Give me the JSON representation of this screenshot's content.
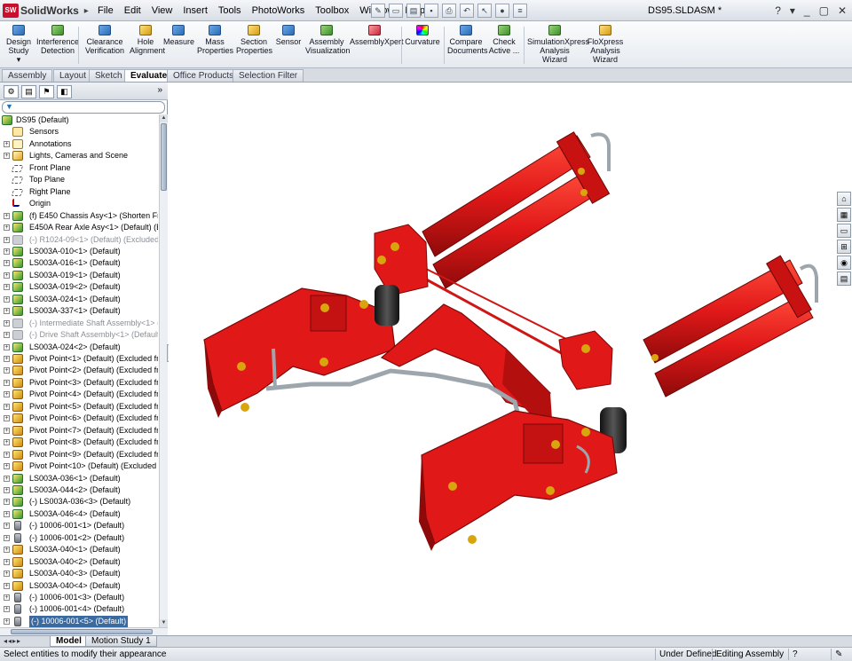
{
  "app": {
    "name": "SolidWorks",
    "logo_mark": "SW",
    "document_title": "DS95.SLDASM *"
  },
  "menu": [
    "File",
    "Edit",
    "View",
    "Insert",
    "Tools",
    "PhotoWorks",
    "Toolbox",
    "Window",
    "Help"
  ],
  "window_buttons": [
    "?",
    "▾",
    "_",
    "▢",
    "✕"
  ],
  "commands": [
    {
      "label1": "Design",
      "label2": "Study",
      "extra": "▾",
      "icon": "design-study-icon",
      "cls": ""
    },
    {
      "label1": "Interference",
      "label2": "Detection",
      "icon": "interference-detection-icon",
      "cls": "g"
    },
    {
      "label1": "Clearance",
      "label2": "Verification",
      "icon": "clearance-verification-icon",
      "cls": ""
    },
    {
      "label1": "Hole",
      "label2": "Alignment",
      "icon": "hole-alignment-icon",
      "cls": "y"
    },
    {
      "label1": "Measure",
      "label2": "",
      "icon": "measure-icon",
      "cls": ""
    },
    {
      "label1": "Mass",
      "label2": "Properties",
      "icon": "mass-properties-icon",
      "cls": ""
    },
    {
      "label1": "Section",
      "label2": "Properties",
      "icon": "section-properties-icon",
      "cls": "y"
    },
    {
      "label1": "Sensor",
      "label2": "",
      "icon": "sensor-icon",
      "cls": ""
    },
    {
      "label1": "Assembly",
      "label2": "Visualization",
      "icon": "assembly-visualization-icon",
      "cls": "g"
    },
    {
      "label1": "AssemblyXpert",
      "label2": "",
      "icon": "assemblyxpert-icon",
      "cls": "r"
    },
    {
      "label1": "Curvature",
      "label2": "",
      "icon": "curvature-icon",
      "cls": "m"
    },
    {
      "label1": "Compare",
      "label2": "Documents",
      "icon": "compare-documents-icon",
      "cls": ""
    },
    {
      "label1": "Check",
      "label2": "Active ...",
      "icon": "check-active-icon",
      "cls": "g"
    },
    {
      "label1": "SimulationXpress",
      "label2": "Analysis Wizard",
      "icon": "simulationxpress-icon",
      "cls": "g"
    },
    {
      "label1": "FloXpress",
      "label2": "Analysis",
      "label3": "Wizard",
      "icon": "floxpress-icon",
      "cls": "y"
    }
  ],
  "tabs": [
    {
      "label": "Assembly",
      "active": false
    },
    {
      "label": "Layout",
      "active": false
    },
    {
      "label": "Sketch",
      "active": false
    },
    {
      "label": "Evaluate",
      "active": true
    },
    {
      "label": "Office Products",
      "active": false
    },
    {
      "label": "Selection Filter",
      "active": false
    }
  ],
  "tree": [
    {
      "text": "DS95  (Default)",
      "icon": "asm",
      "expander": "",
      "indent": 0,
      "state": "normal"
    },
    {
      "text": "Sensors",
      "icon": "sens",
      "expander": "",
      "indent": 1,
      "state": "normal"
    },
    {
      "text": "Annotations",
      "icon": "ann",
      "expander": "+",
      "indent": 1,
      "state": "normal"
    },
    {
      "text": "Lights, Cameras and Scene",
      "icon": "light",
      "expander": "+",
      "indent": 1,
      "state": "normal"
    },
    {
      "text": "Front Plane",
      "icon": "plane",
      "expander": "",
      "indent": 1,
      "state": "normal"
    },
    {
      "text": "Top Plane",
      "icon": "plane",
      "expander": "",
      "indent": 1,
      "state": "normal"
    },
    {
      "text": "Right Plane",
      "icon": "plane",
      "expander": "",
      "indent": 1,
      "state": "normal"
    },
    {
      "text": "Origin",
      "icon": "orig",
      "expander": "",
      "indent": 1,
      "state": "normal"
    },
    {
      "text": "(f) E450 Chassis Asy<1> (Shorten Frame)",
      "icon": "asm",
      "expander": "+",
      "indent": 1,
      "state": "normal"
    },
    {
      "text": "E450A Rear Axle Asy<1> (Default) (Exclu",
      "icon": "asm",
      "expander": "+",
      "indent": 1,
      "state": "normal"
    },
    {
      "text": "(-) R1024-09<1> (Default) (Excluded from",
      "icon": "supa",
      "expander": "+",
      "indent": 1,
      "state": "sup"
    },
    {
      "text": "LS003A-010<1> (Default)",
      "icon": "asm",
      "expander": "+",
      "indent": 1,
      "state": "normal"
    },
    {
      "text": "LS003A-016<1> (Default)",
      "icon": "asm",
      "expander": "+",
      "indent": 1,
      "state": "normal"
    },
    {
      "text": "LS003A-019<1> (Default)",
      "icon": "asm",
      "expander": "+",
      "indent": 1,
      "state": "normal"
    },
    {
      "text": "LS003A-019<2> (Default)",
      "icon": "asm",
      "expander": "+",
      "indent": 1,
      "state": "normal"
    },
    {
      "text": "LS003A-024<1> (Default)",
      "icon": "asm",
      "expander": "+",
      "indent": 1,
      "state": "normal"
    },
    {
      "text": "LS003A-337<1> (Default)",
      "icon": "asm",
      "expander": "+",
      "indent": 1,
      "state": "normal"
    },
    {
      "text": "(-) Intermediate Shaft Assembly<1> (Defau",
      "icon": "supa",
      "expander": "+",
      "indent": 1,
      "state": "sup"
    },
    {
      "text": "(-) Drive Shaft Assembly<1> (Default)",
      "icon": "supa",
      "expander": "+",
      "indent": 1,
      "state": "sup"
    },
    {
      "text": "LS003A-024<2> (Default)",
      "icon": "asm",
      "expander": "+",
      "indent": 1,
      "state": "normal"
    },
    {
      "text": "Pivot Point<1> (Default) (Excluded from B",
      "icon": "prt",
      "expander": "+",
      "indent": 1,
      "state": "normal"
    },
    {
      "text": "Pivot Point<2> (Default) (Excluded from B",
      "icon": "prt",
      "expander": "+",
      "indent": 1,
      "state": "normal"
    },
    {
      "text": "Pivot Point<3> (Default) (Excluded from B",
      "icon": "prt",
      "expander": "+",
      "indent": 1,
      "state": "normal"
    },
    {
      "text": "Pivot Point<4> (Default) (Excluded from B",
      "icon": "prt",
      "expander": "+",
      "indent": 1,
      "state": "normal"
    },
    {
      "text": "Pivot Point<5> (Default) (Excluded from B",
      "icon": "prt",
      "expander": "+",
      "indent": 1,
      "state": "normal"
    },
    {
      "text": "Pivot Point<6> (Default) (Excluded from B",
      "icon": "prt",
      "expander": "+",
      "indent": 1,
      "state": "normal"
    },
    {
      "text": "Pivot Point<7> (Default) (Excluded from B",
      "icon": "prt",
      "expander": "+",
      "indent": 1,
      "state": "normal"
    },
    {
      "text": "Pivot Point<8> (Default) (Excluded from B",
      "icon": "prt",
      "expander": "+",
      "indent": 1,
      "state": "normal"
    },
    {
      "text": "Pivot Point<9> (Default) (Excluded from B",
      "icon": "prt",
      "expander": "+",
      "indent": 1,
      "state": "normal"
    },
    {
      "text": "Pivot Point<10> (Default) (Excluded from",
      "icon": "prt",
      "expander": "+",
      "indent": 1,
      "state": "normal"
    },
    {
      "text": "LS003A-036<1> (Default)",
      "icon": "asm",
      "expander": "+",
      "indent": 1,
      "state": "normal"
    },
    {
      "text": "LS003A-044<2> (Default)",
      "icon": "asm",
      "expander": "+",
      "indent": 1,
      "state": "normal"
    },
    {
      "text": "(-) LS003A-036<3> (Default)",
      "icon": "asm",
      "expander": "+",
      "indent": 1,
      "state": "normal"
    },
    {
      "text": "LS003A-046<4> (Default)",
      "icon": "asm",
      "expander": "+",
      "indent": 1,
      "state": "normal"
    },
    {
      "text": "(-) 10006-001<1> (Default)",
      "icon": "bolt",
      "expander": "+",
      "indent": 1,
      "state": "normal"
    },
    {
      "text": "(-) 10006-001<2> (Default)",
      "icon": "bolt",
      "expander": "+",
      "indent": 1,
      "state": "normal"
    },
    {
      "text": "LS003A-040<1> (Default)",
      "icon": "prt",
      "expander": "+",
      "indent": 1,
      "state": "normal"
    },
    {
      "text": "LS003A-040<2> (Default)",
      "icon": "prt",
      "expander": "+",
      "indent": 1,
      "state": "normal"
    },
    {
      "text": "LS003A-040<3> (Default)",
      "icon": "prt",
      "expander": "+",
      "indent": 1,
      "state": "normal"
    },
    {
      "text": "LS003A-040<4> (Default)",
      "icon": "prt",
      "expander": "+",
      "indent": 1,
      "state": "normal"
    },
    {
      "text": "(-) 10006-001<3> (Default)",
      "icon": "bolt",
      "expander": "+",
      "indent": 1,
      "state": "normal"
    },
    {
      "text": "(-) 10006-001<4> (Default)",
      "icon": "bolt",
      "expander": "+",
      "indent": 1,
      "state": "normal"
    },
    {
      "text": "(-) 10006-001<5> (Default)",
      "icon": "bolt",
      "expander": "+",
      "indent": 1,
      "state": "sel"
    }
  ],
  "bottom_tabs": [
    {
      "label": "Model",
      "active": true
    },
    {
      "label": "Motion Study 1",
      "active": false
    }
  ],
  "status": {
    "message": "Select entities to modify their appearance",
    "definition": "Under Defined",
    "mode": "Editing Assembly",
    "help": "?"
  },
  "colors": {
    "part_red": "#e01818",
    "part_dark": "#8e0a0a",
    "rod_gray": "#9ea6ad",
    "bellows": "#2a2a2a",
    "bolt_yellow": "#d9a50f",
    "accent": "#3b6aa0"
  }
}
